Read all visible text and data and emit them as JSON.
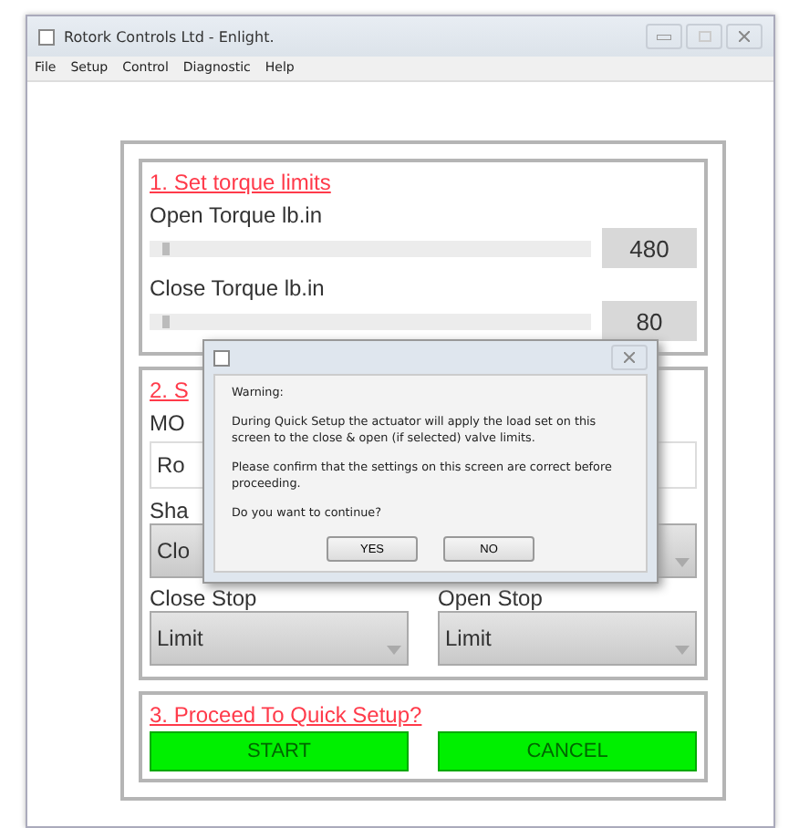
{
  "window": {
    "title": "Rotork Controls Ltd - Enlight."
  },
  "menu": [
    "File",
    "Setup",
    "Control",
    "Diagnostic",
    "Help"
  ],
  "torque": {
    "heading": "1. Set torque limits",
    "rows": [
      {
        "label": "Open  Torque lb.in",
        "level": 0.03,
        "value": "480"
      },
      {
        "label": "Close  Torque lb.in",
        "level": 0.03,
        "value": "80"
      }
    ]
  },
  "section2": {
    "heading": "2. S",
    "mode_label": "MO",
    "mode_value": "Ro",
    "shape_label": "Sha",
    "shape_value": "Clo",
    "stops": [
      {
        "label": "Close Stop",
        "value": "Limit"
      },
      {
        "label": "Open Stop",
        "value": "Limit"
      }
    ]
  },
  "section3": {
    "heading": "3. Proceed To Quick Setup?",
    "buttons": [
      "START",
      "CANCEL"
    ]
  },
  "dialog": {
    "title_label": "Warning:",
    "paragraphs": [
      "During Quick Setup the actuator will apply the load set on this screen to the close & open (if selected) valve  limits.",
      "Please confirm that the settings on this screen are correct before proceeding.",
      "Do you want to continue?"
    ],
    "buttons": [
      "YES",
      "NO"
    ]
  }
}
